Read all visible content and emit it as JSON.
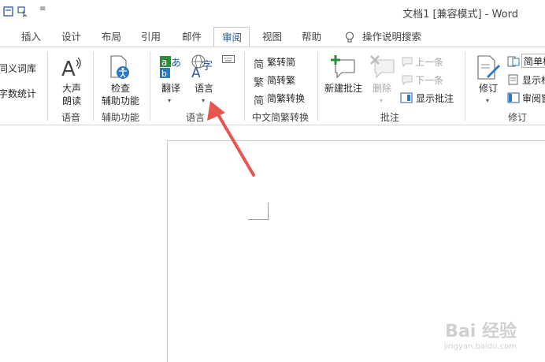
{
  "window": {
    "title": "文档1 [兼容模式]  -  Word"
  },
  "tabs": [
    "插入",
    "设计",
    "布局",
    "引用",
    "邮件",
    "审阅",
    "视图",
    "帮助",
    "操作说明搜索"
  ],
  "ribbon": {
    "proofing": {
      "thesaurus": "同义词库",
      "wordcount": "字数统计"
    },
    "speech": {
      "read_aloud_1": "大声",
      "read_aloud_2": "朗读",
      "group": "语音"
    },
    "accessibility": {
      "check_1": "检查",
      "check_2": "辅助功能",
      "group": "辅助功能"
    },
    "language": {
      "translate": "翻译",
      "language": "语言",
      "group": "语言"
    },
    "chinese": {
      "to_simplified": "繁转简",
      "to_traditional": "简转繁",
      "convert": "简繁转换",
      "group": "中文简繁转换"
    },
    "comments": {
      "new": "新建批注",
      "delete": "删除",
      "prev": "上一条",
      "next": "下一条",
      "show": "显示批注",
      "group": "批注"
    },
    "tracking": {
      "track": "修订",
      "simple_markup": "简单标",
      "show_markup": "显示标",
      "review_pane": "审阅窗",
      "group": "修订"
    }
  },
  "watermark": {
    "main": "Bai 经验",
    "sub": "jingyan.baidu.com"
  },
  "colors": {
    "accent": "#2b579a",
    "arrow": "#e8554e"
  }
}
